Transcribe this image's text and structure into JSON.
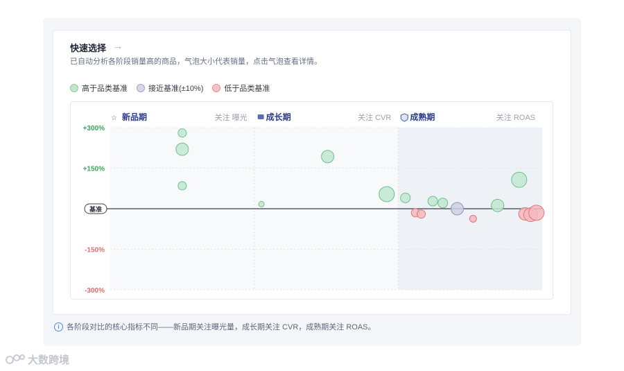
{
  "header": {
    "title": "快速选择",
    "subtitle": "已自动分析各阶段销量高的商品，气泡大小代表销量，点击气泡查看详情。"
  },
  "legend": [
    {
      "label": "高于品类基准",
      "fill": "#bfe8cf",
      "stroke": "#86cfa2"
    },
    {
      "label": "接近基准(±10%)",
      "fill": "#d3d7e6",
      "stroke": "#9ea5c2"
    },
    {
      "label": "低于品类基准",
      "fill": "#f6c2c5",
      "stroke": "#e98f95"
    }
  ],
  "colors": {
    "above": {
      "fill": "#bfe8cf",
      "stroke": "#6fbf8c"
    },
    "near": {
      "fill": "#ccd0e3",
      "stroke": "#8e96b8"
    },
    "below": {
      "fill": "#f4b9bd",
      "stroke": "#e0757d"
    },
    "stage_label": "#2b3a8c",
    "positive_tick": "#3aa35c",
    "negative_tick": "#e06b6b"
  },
  "chart_data": {
    "type": "scatter",
    "y_tick_labels": [
      "+300%",
      "+150%",
      "基准",
      "-150%",
      "-300%"
    ],
    "y_ticks": [
      300,
      150,
      0,
      -150,
      -300
    ],
    "ylim": [
      -300,
      300
    ],
    "baseline_label": "基准",
    "stages": [
      {
        "name": "新品期",
        "icon": "star-icon",
        "focus": "关注 曝光",
        "shaded": false
      },
      {
        "name": "成长期",
        "icon": "box-icon",
        "focus": "关注 CVR",
        "shaded": false
      },
      {
        "name": "成熟期",
        "icon": "shield-icon",
        "focus": "关注 ROAS",
        "shaded": true
      }
    ],
    "points": [
      {
        "stage": 0,
        "x": 0.5,
        "y": 280,
        "size": 6,
        "status": "above"
      },
      {
        "stage": 0,
        "x": 0.5,
        "y": 220,
        "size": 9,
        "status": "above"
      },
      {
        "stage": 0,
        "x": 0.5,
        "y": 85,
        "size": 6,
        "status": "above"
      },
      {
        "stage": 1,
        "x": 0.05,
        "y": 17,
        "size": 4,
        "status": "above"
      },
      {
        "stage": 1,
        "x": 0.51,
        "y": 193,
        "size": 9,
        "status": "above"
      },
      {
        "stage": 1,
        "x": 0.92,
        "y": 54,
        "size": 11,
        "status": "above"
      },
      {
        "stage": 2,
        "x": 0.05,
        "y": 40,
        "size": 7,
        "status": "above"
      },
      {
        "stage": 2,
        "x": 0.12,
        "y": -15,
        "size": 6,
        "status": "below"
      },
      {
        "stage": 2,
        "x": 0.16,
        "y": -20,
        "size": 6,
        "status": "below"
      },
      {
        "stage": 2,
        "x": 0.24,
        "y": 28,
        "size": 7,
        "status": "above"
      },
      {
        "stage": 2,
        "x": 0.31,
        "y": 21,
        "size": 7,
        "status": "above"
      },
      {
        "stage": 2,
        "x": 0.41,
        "y": 0,
        "size": 9,
        "status": "near"
      },
      {
        "stage": 2,
        "x": 0.52,
        "y": -37,
        "size": 5,
        "status": "below"
      },
      {
        "stage": 2,
        "x": 0.69,
        "y": 12,
        "size": 9,
        "status": "above"
      },
      {
        "stage": 2,
        "x": 0.84,
        "y": 107,
        "size": 11,
        "status": "above"
      },
      {
        "stage": 2,
        "x": 0.88,
        "y": -19,
        "size": 9,
        "status": "below"
      },
      {
        "stage": 2,
        "x": 0.92,
        "y": -22,
        "size": 10,
        "status": "below"
      },
      {
        "stage": 2,
        "x": 0.96,
        "y": -15,
        "size": 11,
        "status": "below"
      }
    ]
  },
  "footer": {
    "note": "各阶段对比的核心指标不同——新品期关注曝光量，成长期关注 CVR，成熟期关注 ROAS。"
  },
  "watermark": {
    "text": "大数跨境"
  }
}
